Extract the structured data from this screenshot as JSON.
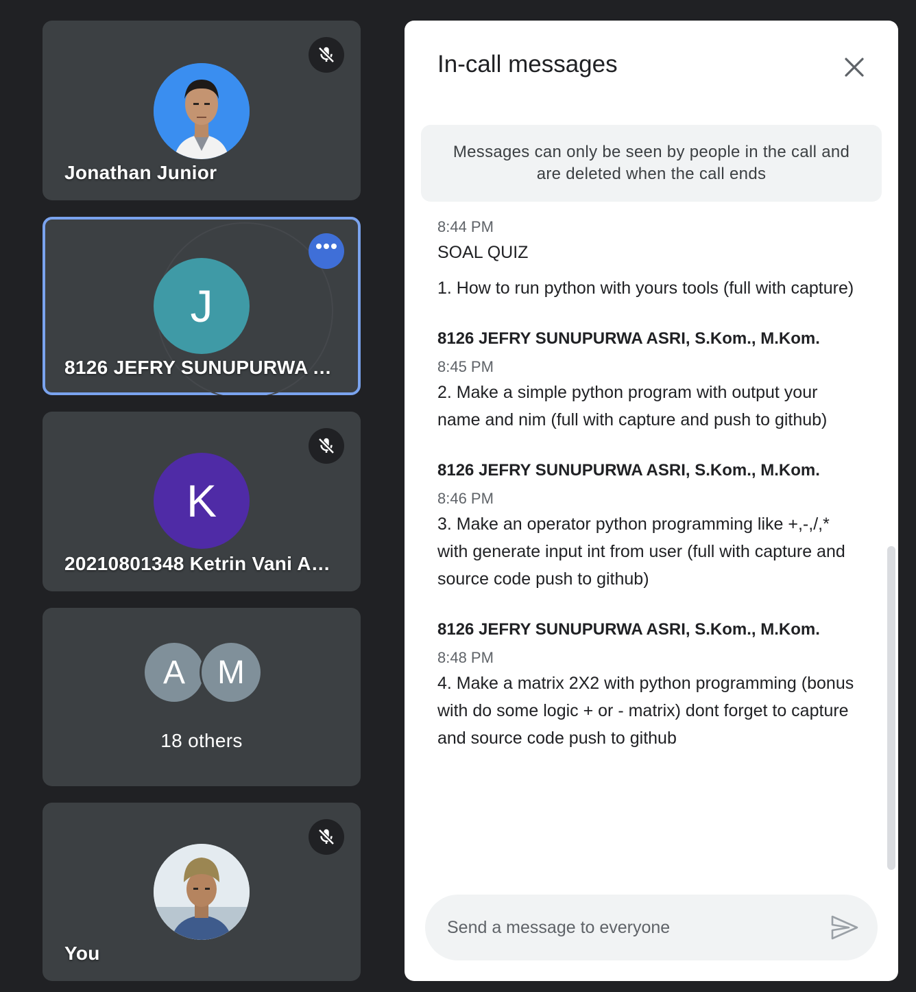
{
  "participants": [
    {
      "name": "Jonathan Junior",
      "muted": true,
      "avatar_kind": "photo-portrait"
    },
    {
      "name": "8126 JEFRY SUNUPURWA AS...",
      "initial": "J",
      "avatar_color": "#3f9aa6",
      "active": true
    },
    {
      "name": "20210801348 Ketrin Vani An...",
      "initial": "K",
      "avatar_color": "#4f2ba6",
      "muted": true
    },
    {
      "initials": [
        "A",
        "M"
      ],
      "others_label": "18 others"
    },
    {
      "name": "You",
      "muted": true,
      "avatar_kind": "photo-self"
    }
  ],
  "chat": {
    "title": "In-call messages",
    "notice": "Messages can only be seen by people in the call and are deleted when the call ends",
    "messages": [
      {
        "time": "8:44 PM",
        "lines": [
          "SOAL QUIZ",
          "1. How to run python with yours tools (full with capture)"
        ]
      },
      {
        "sender": "8126 JEFRY SUNUPURWA ASRI, S.Kom., M.Kom.",
        "time": "8:45 PM",
        "text": "2. Make a simple python program with output your name and nim (full with capture and push to github)"
      },
      {
        "sender": "8126 JEFRY SUNUPURWA ASRI, S.Kom., M.Kom.",
        "time": "8:46 PM",
        "text": "3. Make an operator python programming like +,-,/,* with generate input int from user (full with capture and source code push to github)"
      },
      {
        "sender": "8126 JEFRY SUNUPURWA ASRI, S.Kom., M.Kom.",
        "time": "8:48 PM",
        "text": "4. Make a matrix 2X2 with python programming (bonus with do some logic + or - matrix) dont forget to capture and source code push to github"
      }
    ],
    "input_placeholder": "Send a message to everyone",
    "icons": {
      "close": "close-icon",
      "send": "send-icon",
      "mute": "mic-off-icon",
      "more": "more-horizontal-icon"
    }
  },
  "colors": {
    "background": "#202124",
    "tile": "#3c4043",
    "active_border": "#7aa3ee",
    "more_button": "#3f6fd8"
  }
}
